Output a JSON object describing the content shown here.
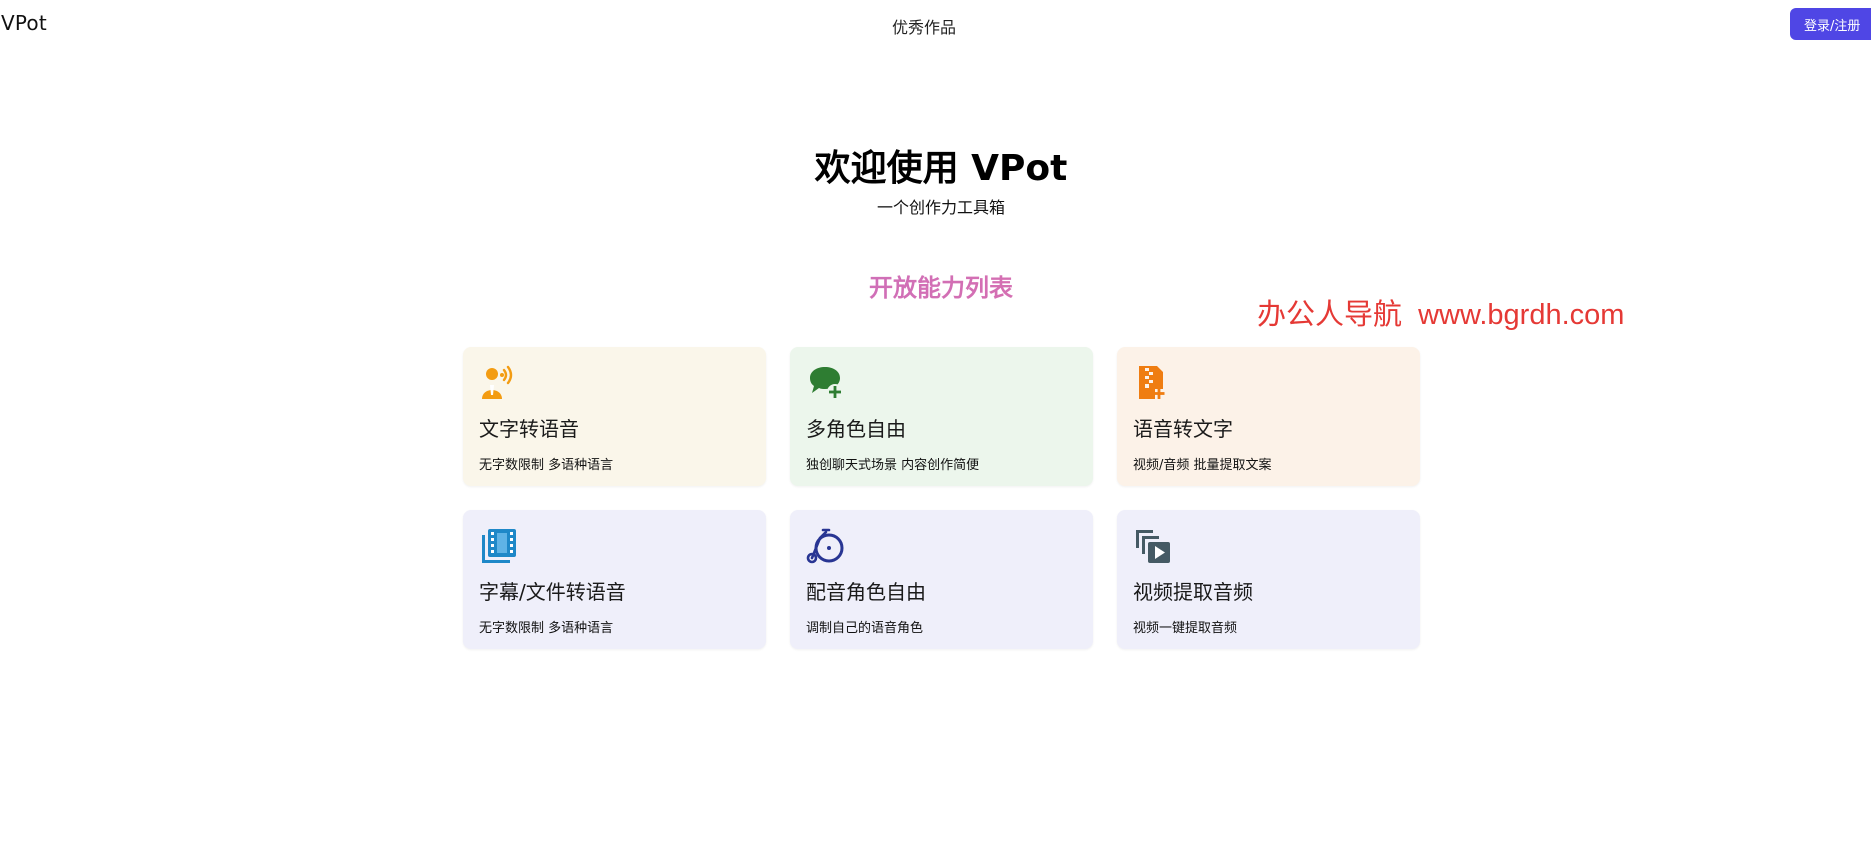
{
  "header": {
    "brand": "VPot",
    "nav_link": "优秀作品",
    "login_label": "登录/注册"
  },
  "hero": {
    "title": "欢迎使用 VPot",
    "subtitle": "一个创作力工具箱"
  },
  "section": {
    "title": "开放能力列表"
  },
  "watermark": "办公人导航  www.bgrdh.com",
  "cards": [
    {
      "title": "文字转语音",
      "desc": "无字数限制 多语种语言",
      "icon": "speaker-person-icon",
      "bg": "#faf6ea"
    },
    {
      "title": "多角色自由",
      "desc": "独创聊天式场景 内容创作简便",
      "icon": "chat-add-icon",
      "bg": "#ecf6ec"
    },
    {
      "title": "语音转文字",
      "desc": "视频/音频 批量提取文案",
      "icon": "file-zip-add-icon",
      "bg": "#fcf2e8"
    },
    {
      "title": "字幕/文件转语音",
      "desc": "无字数限制 多语种语言",
      "icon": "film-library-icon",
      "bg": "#efeffa"
    },
    {
      "title": "配音角色自由",
      "desc": "调制自己的语音角色",
      "icon": "penny-farthing-icon",
      "bg": "#efeffa"
    },
    {
      "title": "视频提取音频",
      "desc": "视频一键提取音频",
      "icon": "video-library-icon",
      "bg": "#efeffa"
    }
  ],
  "colors": {
    "accent": "#4f46e5",
    "section_gradient_start": "#b56fd6",
    "section_gradient_end": "#e06f9f",
    "watermark": "#e53935"
  }
}
